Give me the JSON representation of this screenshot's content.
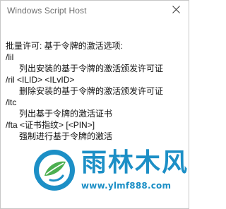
{
  "window": {
    "title": "Windows Script Host",
    "close_icon": "close-icon"
  },
  "message": {
    "lines": [
      "批量许可: 基于令牌的激活选项:",
      "/lil",
      "列出安装的基于令牌的激活颁发许可证",
      "/ril <ILID> <ILvID>",
      "删除安装的基于令牌的激活颁发许可证",
      "/ltc",
      "列出基于令牌的激活证书",
      "/fta <证书指纹> [<PIN>]",
      "强制进行基于令牌的激活"
    ]
  },
  "watermark": {
    "title": "雨林木风",
    "url": "www.ylmf888.com",
    "colors": {
      "primary": "#1c8fc6",
      "leaf": "#4caf50"
    }
  }
}
